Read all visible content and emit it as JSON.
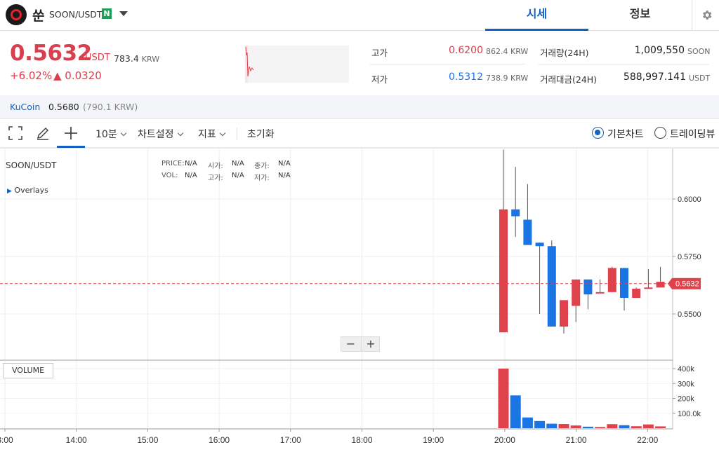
{
  "header": {
    "coin_name": "쑨",
    "pair": "SOON/USDT",
    "badge": "N",
    "tabs": [
      {
        "label": "시세",
        "active": true
      },
      {
        "label": "정보",
        "active": false
      }
    ]
  },
  "price": {
    "current": "0.5632",
    "unit": "USDT",
    "krw_value": "783.4",
    "krw_unit": "KRW",
    "change_pct": "+6.02%",
    "change_amt": "▲ 0.0320"
  },
  "stats": {
    "high_label": "고가",
    "high_value": "0.6200",
    "high_krw": "862.4 KRW",
    "low_label": "저가",
    "low_value": "0.5312",
    "low_krw": "738.9 KRW",
    "volume_label": "거래량(24H)",
    "volume_value": "1,009,550",
    "volume_unit": "SOON",
    "amount_label": "거래대금(24H)",
    "amount_value": "588,997.141",
    "amount_unit": "USDT"
  },
  "exchange": {
    "name": "KuCoin",
    "price": "0.5680",
    "krw": "(790.1 KRW)"
  },
  "toolbar": {
    "interval": "10분",
    "chart_settings": "차트설정",
    "indicators": "지표",
    "reset": "초기화",
    "basic_chart": "기본차트",
    "tradingview": "트레이딩뷰"
  },
  "chart_info": {
    "symbol": "SOON/USDT",
    "overlays": "Overlays",
    "price_key": "PRICE:",
    "price_val": "N/A",
    "open_key": "시가:",
    "open_val": "N/A",
    "close_key": "종가:",
    "close_val": "N/A",
    "vol_key": "VOL:",
    "vol_val": "N/A",
    "high_key": "고가:",
    "high_val": "N/A",
    "low_key": "저가:",
    "low_val": "N/A",
    "zoom_out": "−",
    "zoom_in": "+",
    "volume_label": "VOLUME",
    "last_price_tag": "0.5632"
  },
  "colors": {
    "up": "#e0424c",
    "down": "#1b74e4",
    "accent": "#1261c4"
  },
  "chart_data": {
    "type": "candlestick",
    "x_ticks": [
      "3:00",
      "14:00",
      "15:00",
      "16:00",
      "17:00",
      "18:00",
      "19:00",
      "20:00",
      "21:00",
      "22:00"
    ],
    "y_ticks": [
      "0.6000",
      "0.5750",
      "0.5500"
    ],
    "volume_ticks": [
      "400k",
      "300k",
      "200k",
      "100.0k"
    ],
    "last_price": 0.5632,
    "candles": [
      {
        "time": "20:00",
        "open": 0.542,
        "high": 0.6215,
        "low": 0.542,
        "close": 0.5955,
        "volume": 400000
      },
      {
        "time": "20:10",
        "open": 0.5955,
        "high": 0.614,
        "low": 0.5835,
        "close": 0.5925,
        "volume": 220000
      },
      {
        "time": "20:20",
        "open": 0.591,
        "high": 0.6065,
        "low": 0.5835,
        "close": 0.58,
        "volume": 72000
      },
      {
        "time": "20:30",
        "open": 0.581,
        "high": 0.581,
        "low": 0.55,
        "close": 0.5795,
        "volume": 48000
      },
      {
        "time": "20:40",
        "open": 0.5795,
        "high": 0.582,
        "low": 0.545,
        "close": 0.5445,
        "volume": 30000
      },
      {
        "time": "20:50",
        "open": 0.5445,
        "high": 0.552,
        "low": 0.5415,
        "close": 0.556,
        "volume": 28000
      },
      {
        "time": "21:00",
        "open": 0.5535,
        "high": 0.565,
        "low": 0.5465,
        "close": 0.565,
        "volume": 18000
      },
      {
        "time": "21:10",
        "open": 0.565,
        "high": 0.565,
        "low": 0.552,
        "close": 0.5585,
        "volume": 10000
      },
      {
        "time": "21:20",
        "open": 0.559,
        "high": 0.565,
        "low": 0.559,
        "close": 0.5595,
        "volume": 8000
      },
      {
        "time": "21:30",
        "open": 0.5595,
        "high": 0.5705,
        "low": 0.5595,
        "close": 0.57,
        "volume": 27000
      },
      {
        "time": "21:40",
        "open": 0.57,
        "high": 0.57,
        "low": 0.5515,
        "close": 0.557,
        "volume": 20000
      },
      {
        "time": "21:50",
        "open": 0.557,
        "high": 0.5615,
        "low": 0.557,
        "close": 0.561,
        "volume": 13000
      },
      {
        "time": "22:00",
        "open": 0.561,
        "high": 0.5695,
        "low": 0.561,
        "close": 0.5615,
        "volume": 25000
      },
      {
        "time": "22:10",
        "open": 0.5615,
        "high": 0.5705,
        "low": 0.5615,
        "close": 0.564,
        "volume": 12000
      }
    ]
  }
}
